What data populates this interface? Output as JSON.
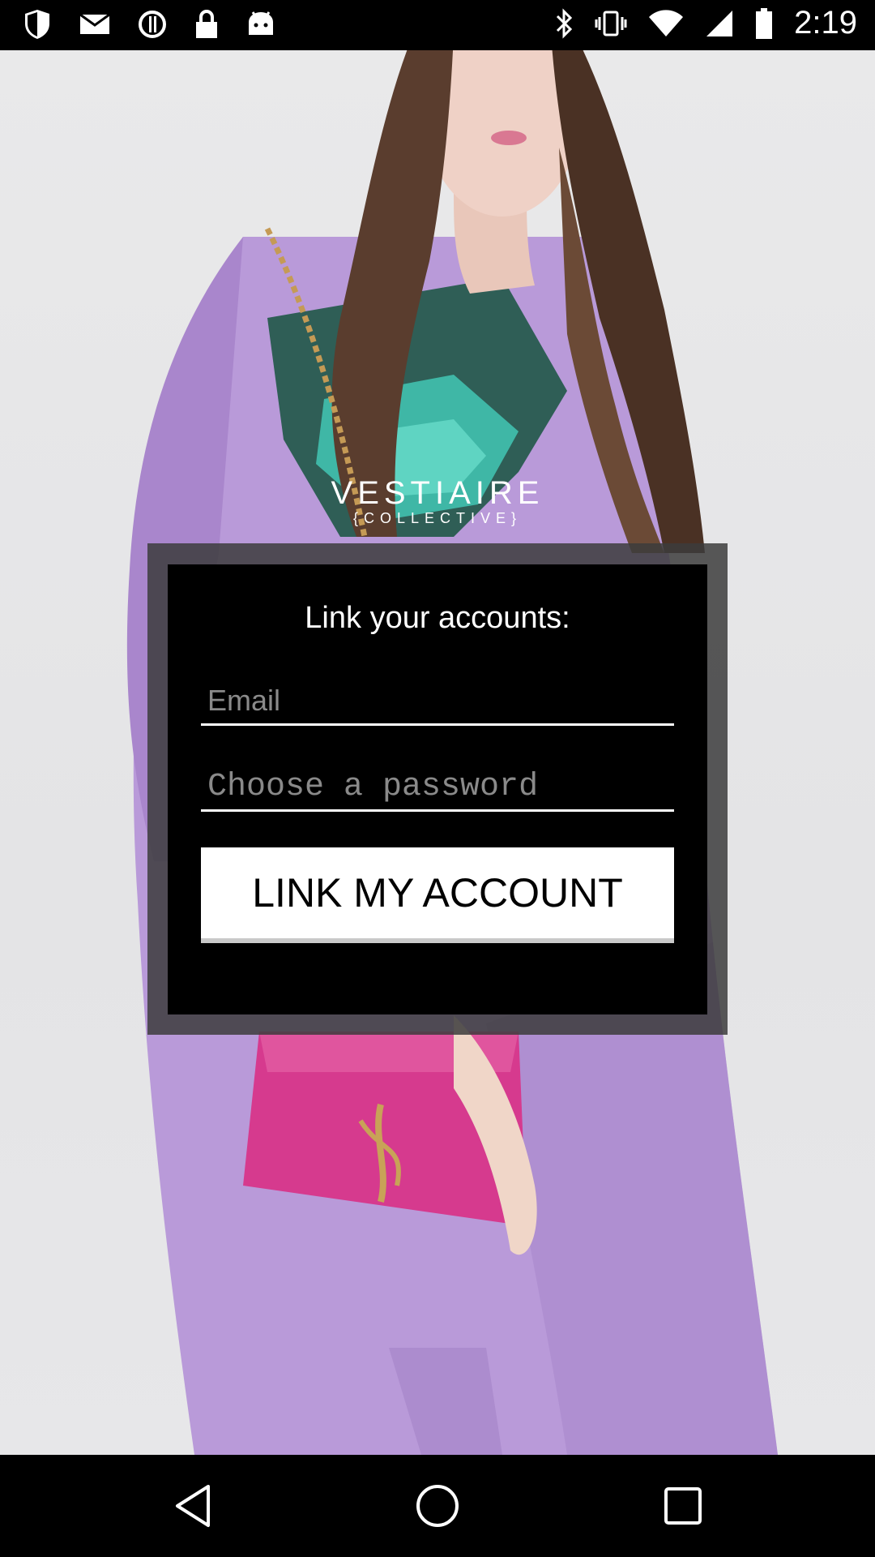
{
  "status_bar": {
    "time": "2:19",
    "left_icons": [
      "shield-icon",
      "mail-icon",
      "alert-circle-icon",
      "lock-icon",
      "android-icon"
    ],
    "right_icons": [
      "bluetooth-icon",
      "vibrate-icon",
      "wifi-icon",
      "signal-icon",
      "battery-icon"
    ]
  },
  "logo": {
    "main": "VESTIAIRE",
    "sub": "{COLLECTIVE}"
  },
  "dialog": {
    "title": "Link your accounts:",
    "email_placeholder": "Email",
    "password_placeholder": "Choose a password",
    "button_label": "LINK MY ACCOUNT"
  },
  "nav_bar": {
    "buttons": [
      "back-icon",
      "home-icon",
      "recent-apps-icon"
    ]
  },
  "colors": {
    "dialog_bg": "#000000",
    "button_bg": "#ffffff",
    "dress": "#b794d8",
    "bag": "#d43a8c"
  }
}
